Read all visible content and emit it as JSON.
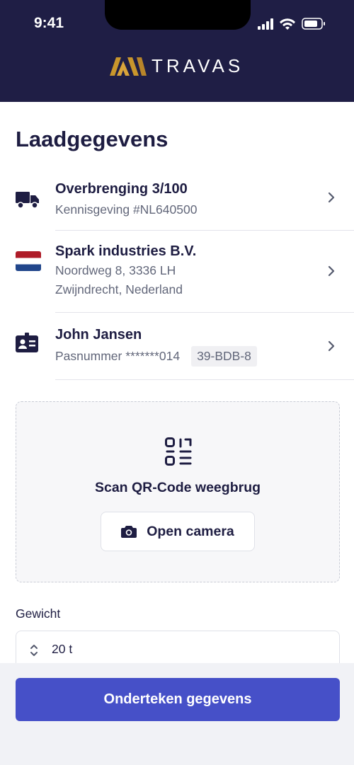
{
  "status_bar": {
    "time": "9:41"
  },
  "header": {
    "logo_text": "TRAVAS"
  },
  "page": {
    "title": "Laadgegevens"
  },
  "items": [
    {
      "title": "Overbrenging 3/100",
      "subtitle": "Kennisgeving #NL640500",
      "icon": "truck-icon"
    },
    {
      "title": "Spark industries B.V.",
      "address_line1": "Noordweg 8, 3336 LH",
      "address_line2": "Zwijndrecht, Nederland",
      "icon": "netherlands-flag-icon"
    },
    {
      "title": "John Jansen",
      "subtitle": "Pasnummer *******014",
      "plate": "39-BDB-8",
      "icon": "id-card-icon"
    }
  ],
  "scan": {
    "label": "Scan QR-Code weegbrug",
    "button_label": "Open camera"
  },
  "weight": {
    "label": "Gewicht",
    "value": "20 t"
  },
  "footer": {
    "button_label": "Onderteken gegevens"
  },
  "colors": {
    "header_bg": "#1f1e45",
    "primary": "#4650c8",
    "logo_gold": "#c9962c",
    "flag_red": "#ae1c28",
    "flag_blue": "#21468b"
  }
}
